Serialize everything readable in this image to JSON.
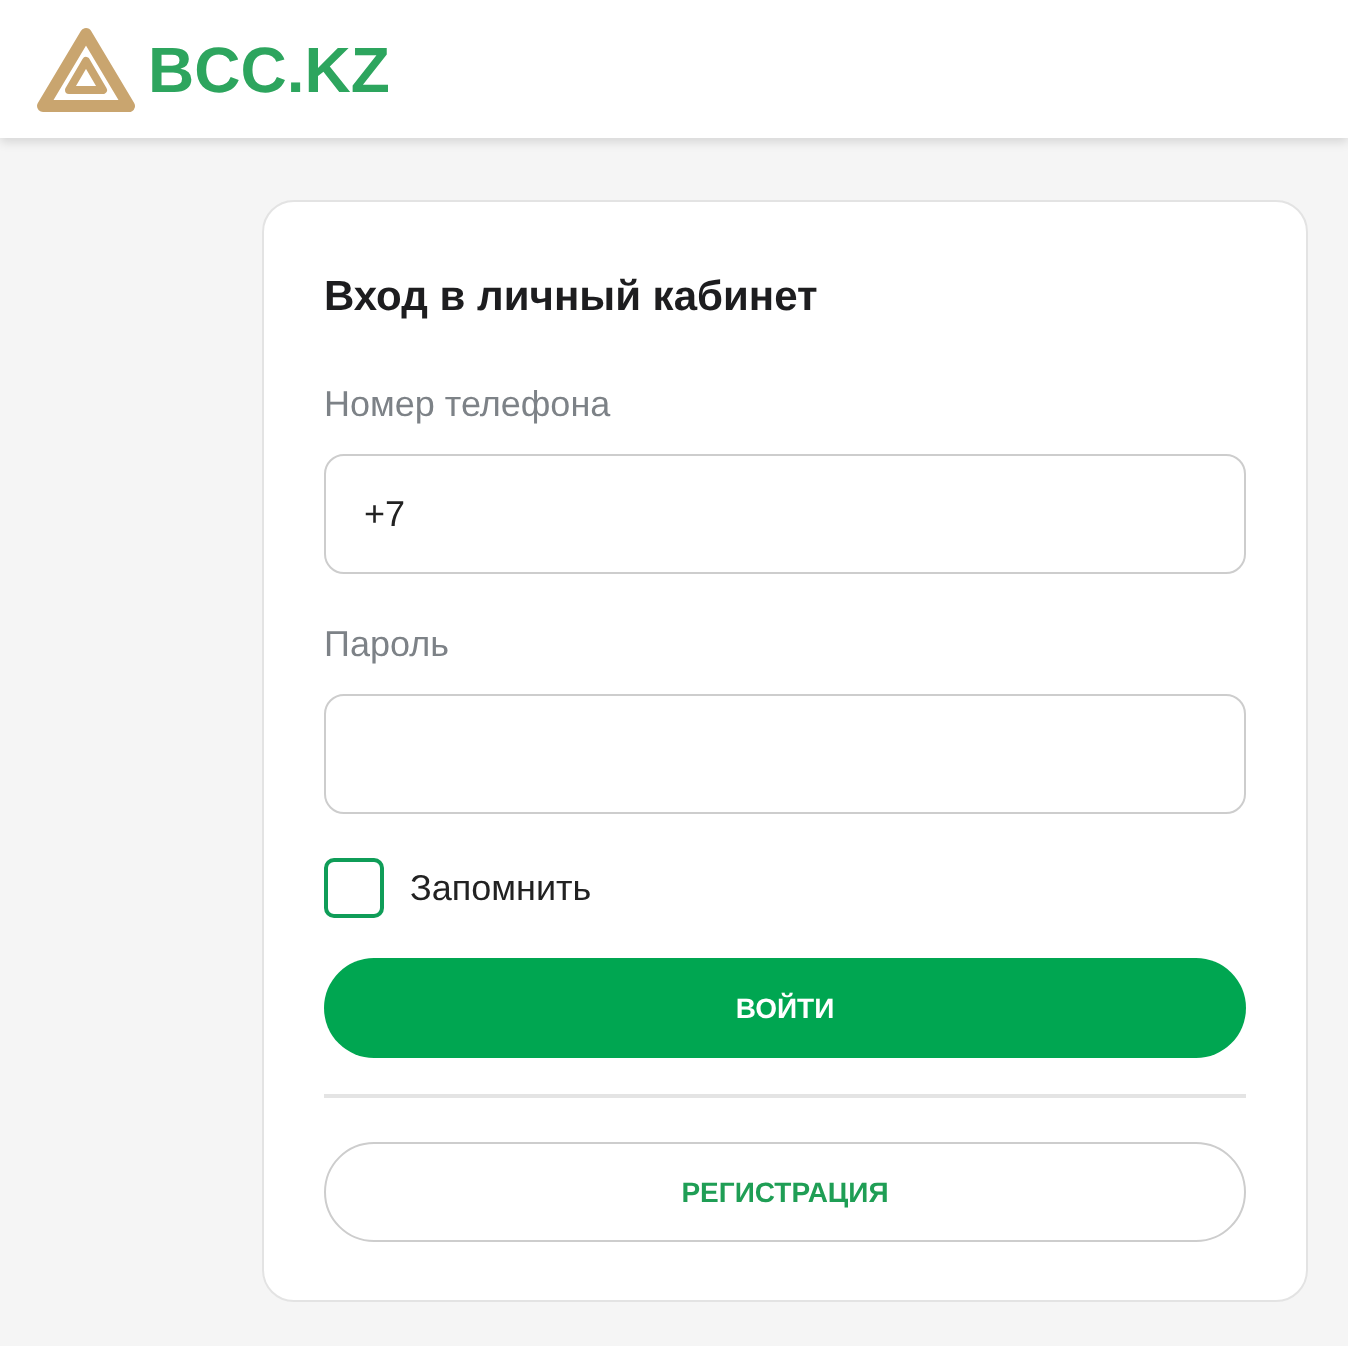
{
  "header": {
    "logo_text": "BCC.KZ"
  },
  "login_form": {
    "title": "Вход в личный кабинет",
    "fields": [
      {
        "label": "Номер телефона",
        "value": "+7",
        "kind": "phone"
      },
      {
        "label": "Пароль",
        "kind": "password"
      }
    ],
    "remember": {
      "label": "Запомнить",
      "checked": false
    },
    "submit_button": {
      "label": "ВОЙТИ"
    },
    "register_button": {
      "label": "РЕГИСТРАЦИЯ"
    }
  }
}
